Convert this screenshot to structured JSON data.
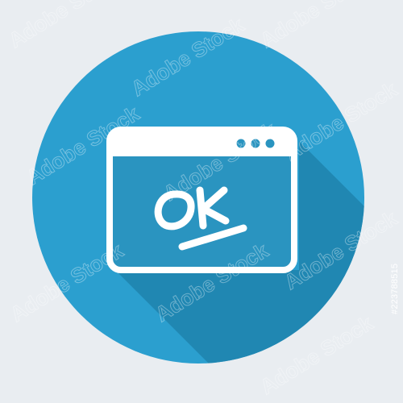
{
  "icon": {
    "subject": "browser-window-ok",
    "colors": {
      "background": "#e9edf1",
      "circle": "#2b9fcf",
      "shadow": "#1e83ad",
      "window_fill": "#2a94c0",
      "stroke": "#ffffff"
    },
    "window_dots": 3,
    "message": "OK"
  },
  "watermark": {
    "brand": "Adobe Stock",
    "stock_id": "#223788515"
  }
}
